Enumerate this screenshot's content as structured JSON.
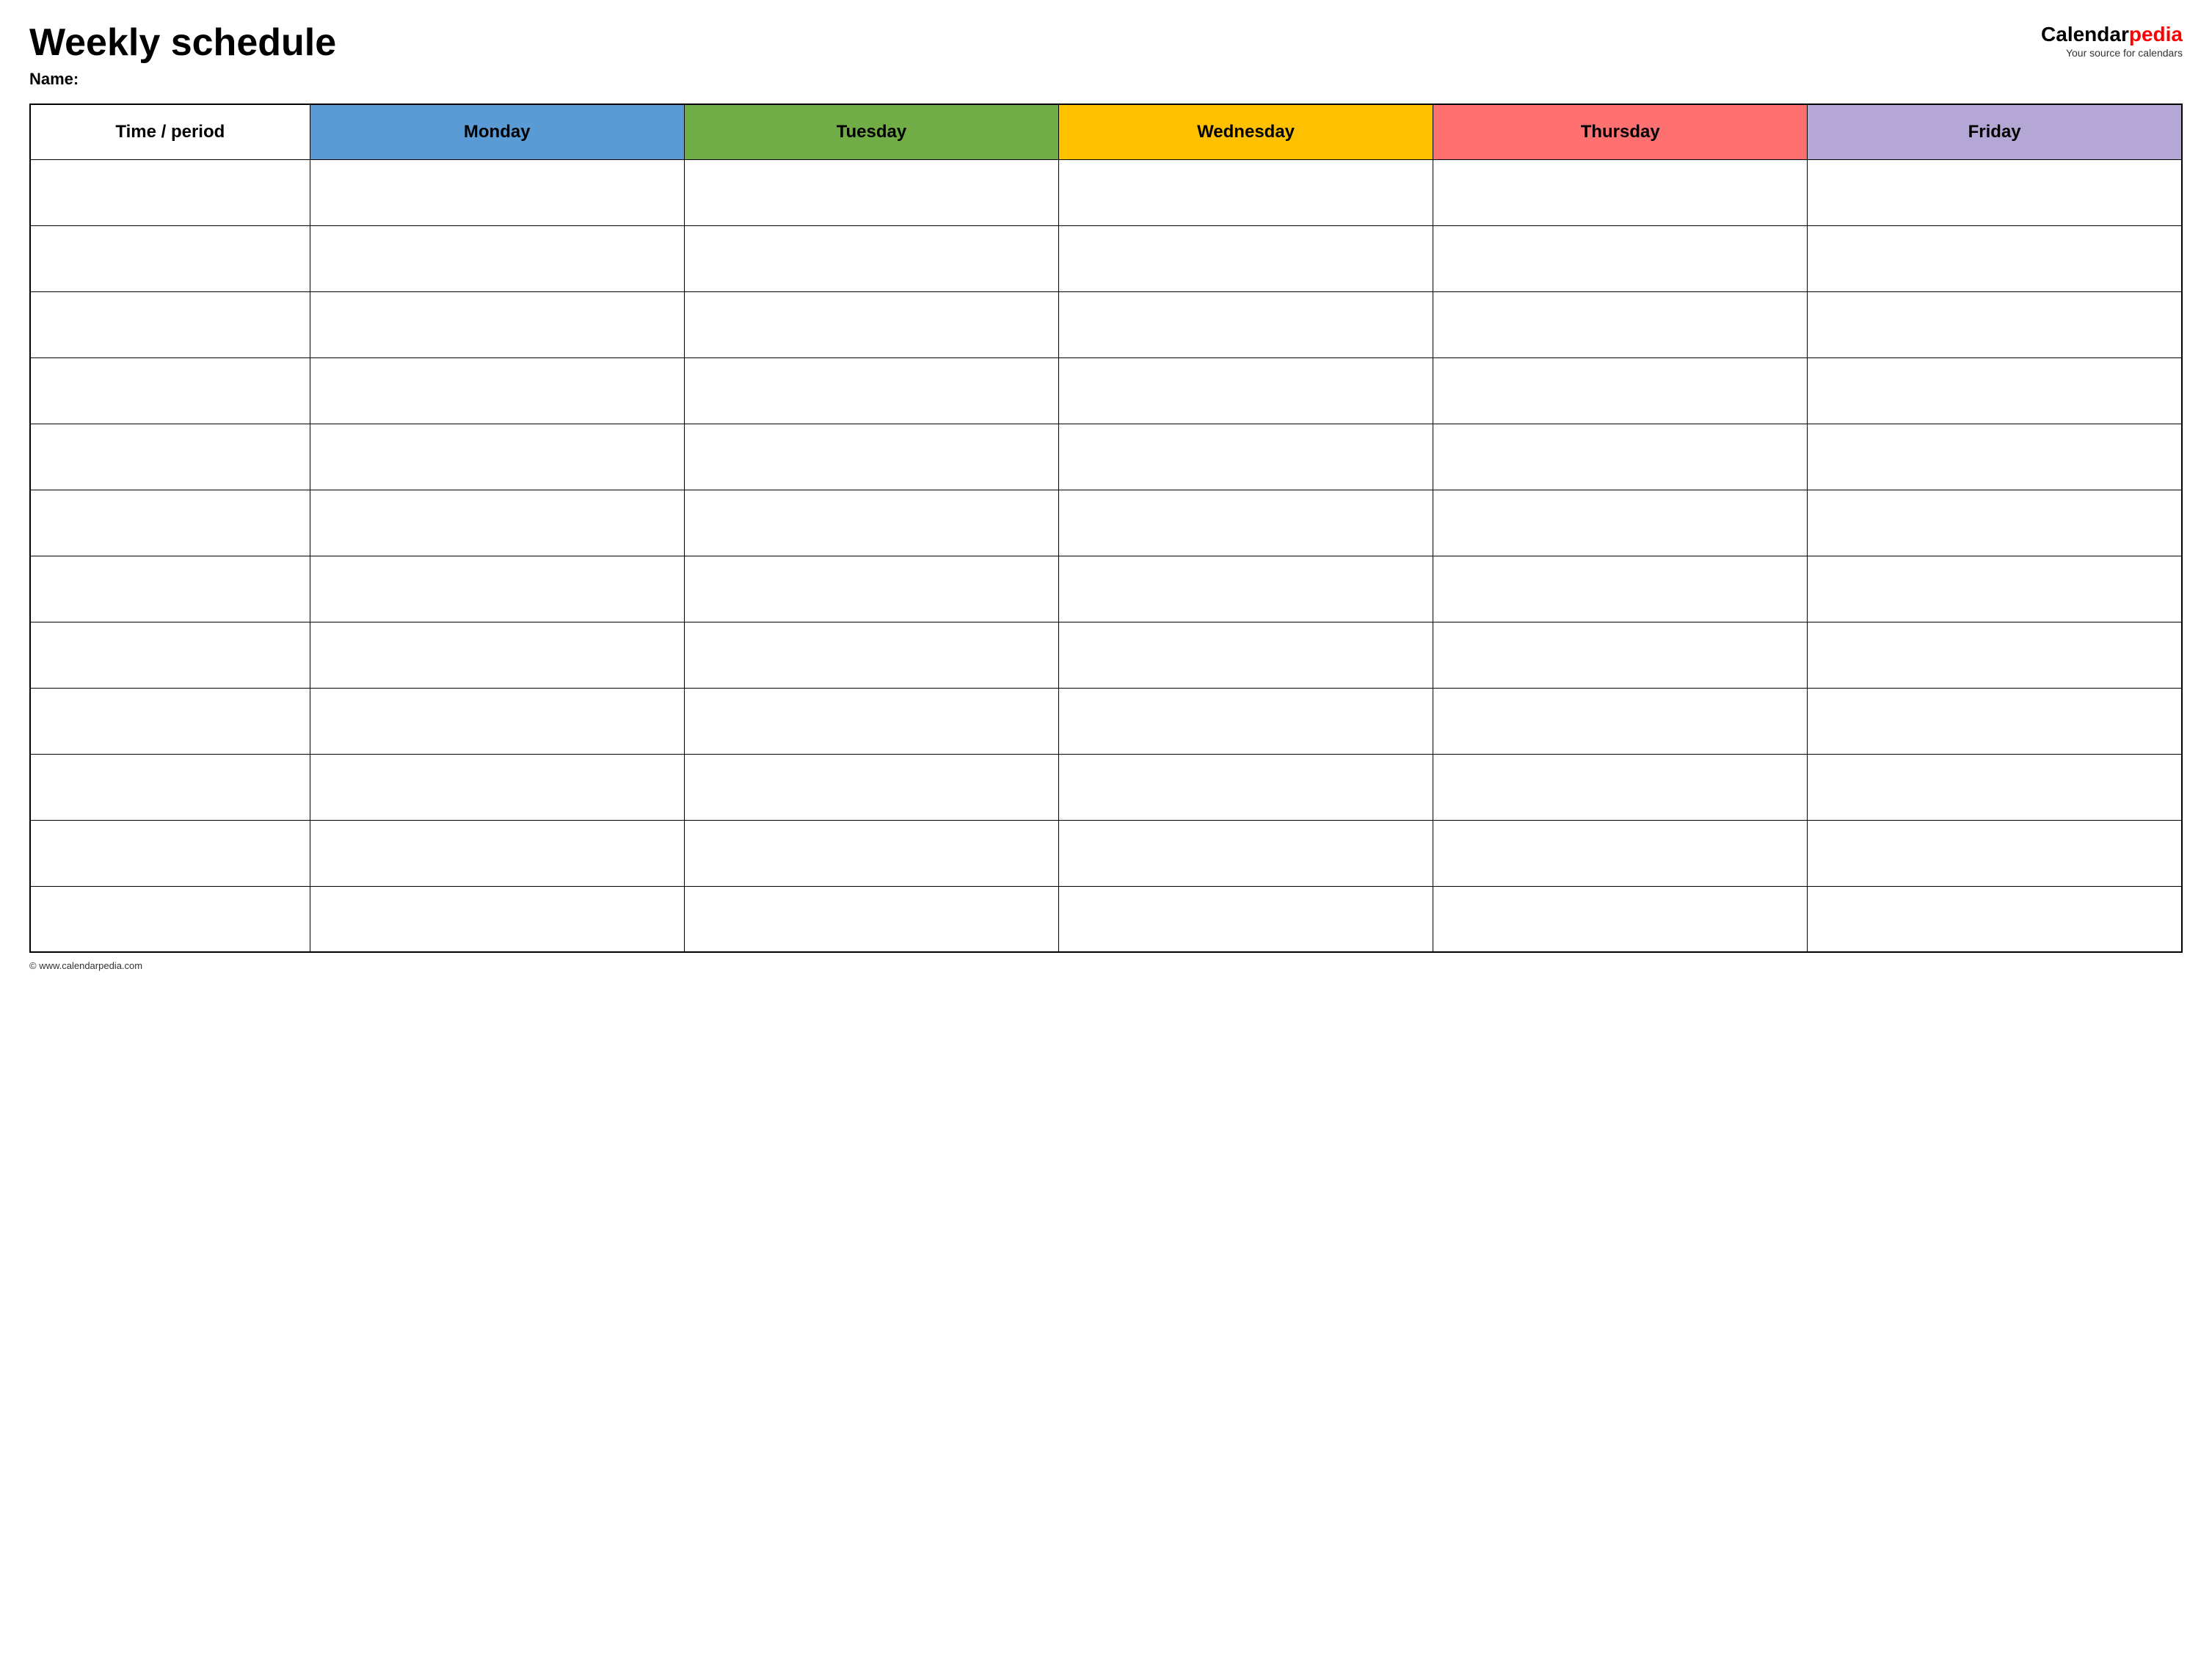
{
  "header": {
    "title": "Weekly schedule",
    "name_label": "Name:",
    "logo_calendar": "Calendar",
    "logo_pedia": "pedia",
    "logo_tagline": "Your source for calendars",
    "logo_accent": "p"
  },
  "table": {
    "columns": [
      {
        "key": "time",
        "label": "Time / period",
        "color": "#ffffff"
      },
      {
        "key": "monday",
        "label": "Monday",
        "color": "#5b9bd5"
      },
      {
        "key": "tuesday",
        "label": "Tuesday",
        "color": "#70ad47"
      },
      {
        "key": "wednesday",
        "label": "Wednesday",
        "color": "#ffc000"
      },
      {
        "key": "thursday",
        "label": "Thursday",
        "color": "#ff7070"
      },
      {
        "key": "friday",
        "label": "Friday",
        "color": "#b4a7d6"
      }
    ],
    "row_count": 12
  },
  "footer": {
    "copyright": "© www.calendarpedia.com"
  }
}
